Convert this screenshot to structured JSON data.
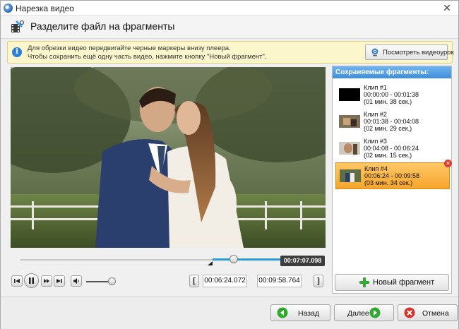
{
  "window": {
    "title": "Нарезка видео",
    "close_glyph": "✕"
  },
  "header": {
    "title": "Разделите файл на фрагменты",
    "icon": "film-cut-icon"
  },
  "info": {
    "line1": "Для обрезки видео передвигайте черные маркеры внизу плеера.",
    "line2": "Чтобы сохранить ещё одну часть видео, нажмите кнопку \"Новый фрагмент\".",
    "icon_glyph": "i",
    "video_lesson_label": "Посмотреть видеоурок"
  },
  "player": {
    "current_time": "00:07:07.098",
    "start_time": "00:06:24.072",
    "end_time": "00:09:58.764",
    "bracket_open": "[",
    "bracket_close": "]",
    "playhead_fraction": 0.712,
    "selection_start_fraction": 0.642,
    "selection_end_fraction": 0.998,
    "volume_fraction": 0.85
  },
  "fragments": {
    "header": "Сохраняемые фрагменты:",
    "clips": [
      {
        "title": "Клип #1",
        "range": "00:00:00 - 00:01:38",
        "duration": "(01 мин. 38 сек.)",
        "selected": false
      },
      {
        "title": "Клип #2",
        "range": "00:01:38 - 00:04:08",
        "duration": "(02 мин. 29 сек.)",
        "selected": false
      },
      {
        "title": "Клип #3",
        "range": "00:04:08 - 00:06:24",
        "duration": "(02 мин. 15 сек.)",
        "selected": false
      },
      {
        "title": "Клип #4",
        "range": "00:06:24 - 00:09:58",
        "duration": "(03 мин. 34 сек.)",
        "selected": true
      }
    ],
    "remove_glyph": "✕",
    "new_fragment_label": "Новый фрагмент"
  },
  "footer": {
    "back_label": "Назад",
    "next_label": "Далее",
    "cancel_label": "Отмена"
  },
  "colors": {
    "accent_blue": "#3e8fdb",
    "selected_orange": "#f6a52a",
    "info_bg": "#fbf6cc",
    "nav_green": "#2faa2f",
    "cancel_red": "#d8322a"
  }
}
